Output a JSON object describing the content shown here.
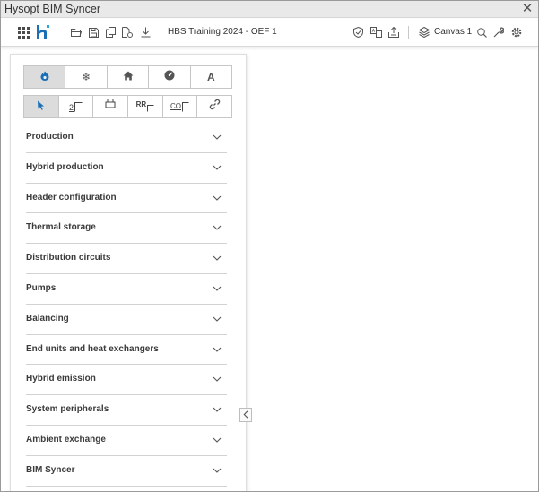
{
  "window": {
    "title": "Hysopt BIM Syncer",
    "close_glyph": "✕"
  },
  "toolbar": {
    "app_menu_icon": "apps-grid-icon",
    "logo_icon": "hysopt-logo-icon",
    "project_name": "HBS Training 2024 - OEF 1",
    "canvas_name": "Canvas 1",
    "brand_color": "#1a6fb5"
  },
  "panel": {
    "category_tabs": [
      {
        "icon": "flame-icon",
        "active": true
      },
      {
        "icon": "snowflake-icon",
        "glyph": "❄",
        "active": false
      },
      {
        "icon": "home-icon",
        "active": false
      },
      {
        "icon": "gauge-icon",
        "active": false
      },
      {
        "icon": "text-tool-icon",
        "label": "A",
        "active": false
      }
    ],
    "tool_tabs": [
      {
        "icon": "pointer-icon",
        "active": true
      },
      {
        "icon": "level-2-icon",
        "label": "2",
        "active": false
      },
      {
        "icon": "connector-icon",
        "active": false
      },
      {
        "icon": "rr-icon",
        "label": "RR",
        "active": false
      },
      {
        "icon": "co-icon",
        "label": "CO",
        "active": false
      },
      {
        "icon": "link-icon",
        "active": false
      }
    ],
    "sections": [
      "Production",
      "Hybrid production",
      "Header configuration",
      "Thermal storage",
      "Distribution circuits",
      "Pumps",
      "Balancing",
      "End units and heat exchangers",
      "Hybrid emission",
      "System peripherals",
      "Ambient exchange",
      "BIM Syncer"
    ],
    "collapse_icon": "chevron-left-icon"
  }
}
